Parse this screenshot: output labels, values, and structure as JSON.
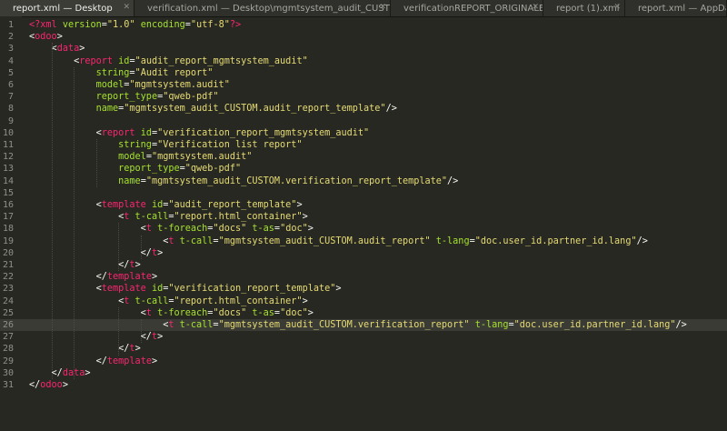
{
  "tabs": [
    {
      "label": "report.xml — Desktop",
      "close": "✕",
      "active": true,
      "width": 148
    },
    {
      "label": "verification.xml — Desktop\\mgmtsystem_audit_CUSTOM\\report",
      "close": "✕",
      "active": false,
      "width": 282
    },
    {
      "label": "verificationREPORT_ORIGINALE.xml",
      "close": "✕",
      "active": false,
      "width": 168
    },
    {
      "label": "report (1).xml",
      "close": "✕",
      "active": false,
      "width": 90
    },
    {
      "label": "report.xml — AppData\\Lo",
      "close": "",
      "active": false,
      "width": 112
    }
  ],
  "current_line": 26,
  "lines": [
    {
      "n": "1",
      "tokens": [
        [
          "<?",
          "#f92672"
        ],
        [
          "xml",
          "#f92672"
        ],
        [
          " version",
          "#a6e22e"
        ],
        [
          "=",
          "#f8f8f2"
        ],
        [
          "\"1.0\"",
          "#e6db74"
        ],
        [
          " encoding",
          "#a6e22e"
        ],
        [
          "=",
          "#f8f8f2"
        ],
        [
          "\"utf-8\"",
          "#e6db74"
        ],
        [
          "?>",
          "#f92672"
        ]
      ]
    },
    {
      "n": "2",
      "tokens": [
        [
          "<",
          "#f8f8f2"
        ],
        [
          "odoo",
          "#f92672"
        ],
        [
          ">",
          "#f8f8f2"
        ]
      ]
    },
    {
      "n": "3",
      "tokens": [
        [
          "    ",
          "#f8f8f2"
        ],
        [
          "<",
          "#f8f8f2"
        ],
        [
          "data",
          "#f92672"
        ],
        [
          ">",
          "#f8f8f2"
        ]
      ]
    },
    {
      "n": "4",
      "tokens": [
        [
          "        ",
          "#f8f8f2"
        ],
        [
          "<",
          "#f8f8f2"
        ],
        [
          "report",
          "#f92672"
        ],
        [
          " id",
          "#a6e22e"
        ],
        [
          "=",
          "#f8f8f2"
        ],
        [
          "\"audit_report_mgmtsystem_audit\"",
          "#e6db74"
        ]
      ]
    },
    {
      "n": "5",
      "tokens": [
        [
          "            ",
          "#f8f8f2"
        ],
        [
          "string",
          "#a6e22e"
        ],
        [
          "=",
          "#f8f8f2"
        ],
        [
          "\"Audit report\"",
          "#e6db74"
        ]
      ]
    },
    {
      "n": "6",
      "tokens": [
        [
          "            ",
          "#f8f8f2"
        ],
        [
          "model",
          "#a6e22e"
        ],
        [
          "=",
          "#f8f8f2"
        ],
        [
          "\"mgmtsystem.audit\"",
          "#e6db74"
        ]
      ]
    },
    {
      "n": "7",
      "tokens": [
        [
          "            ",
          "#f8f8f2"
        ],
        [
          "report_type",
          "#a6e22e"
        ],
        [
          "=",
          "#f8f8f2"
        ],
        [
          "\"qweb-pdf\"",
          "#e6db74"
        ]
      ]
    },
    {
      "n": "8",
      "tokens": [
        [
          "            ",
          "#f8f8f2"
        ],
        [
          "name",
          "#a6e22e"
        ],
        [
          "=",
          "#f8f8f2"
        ],
        [
          "\"mgmtsystem_audit_CUSTOM.audit_report_template\"",
          "#e6db74"
        ],
        [
          "/>",
          "#f8f8f2"
        ]
      ]
    },
    {
      "n": "9",
      "tokens": []
    },
    {
      "n": "10",
      "tokens": [
        [
          "            ",
          "#f8f8f2"
        ],
        [
          "<",
          "#f8f8f2"
        ],
        [
          "report",
          "#f92672"
        ],
        [
          " id",
          "#a6e22e"
        ],
        [
          "=",
          "#f8f8f2"
        ],
        [
          "\"verification_report_mgmtsystem_audit\"",
          "#e6db74"
        ]
      ]
    },
    {
      "n": "11",
      "tokens": [
        [
          "                ",
          "#f8f8f2"
        ],
        [
          "string",
          "#a6e22e"
        ],
        [
          "=",
          "#f8f8f2"
        ],
        [
          "\"Verification list report\"",
          "#e6db74"
        ]
      ]
    },
    {
      "n": "12",
      "tokens": [
        [
          "                ",
          "#f8f8f2"
        ],
        [
          "model",
          "#a6e22e"
        ],
        [
          "=",
          "#f8f8f2"
        ],
        [
          "\"mgmtsystem.audit\"",
          "#e6db74"
        ]
      ]
    },
    {
      "n": "13",
      "tokens": [
        [
          "                ",
          "#f8f8f2"
        ],
        [
          "report_type",
          "#a6e22e"
        ],
        [
          "=",
          "#f8f8f2"
        ],
        [
          "\"qweb-pdf\"",
          "#e6db74"
        ]
      ]
    },
    {
      "n": "14",
      "tokens": [
        [
          "                ",
          "#f8f8f2"
        ],
        [
          "name",
          "#a6e22e"
        ],
        [
          "=",
          "#f8f8f2"
        ],
        [
          "\"mgmtsystem_audit_CUSTOM.verification_report_template\"",
          "#e6db74"
        ],
        [
          "/>",
          "#f8f8f2"
        ]
      ]
    },
    {
      "n": "15",
      "tokens": []
    },
    {
      "n": "16",
      "tokens": [
        [
          "            ",
          "#f8f8f2"
        ],
        [
          "<",
          "#f8f8f2"
        ],
        [
          "template",
          "#f92672"
        ],
        [
          " id",
          "#a6e22e"
        ],
        [
          "=",
          "#f8f8f2"
        ],
        [
          "\"audit_report_template\"",
          "#e6db74"
        ],
        [
          ">",
          "#f8f8f2"
        ]
      ]
    },
    {
      "n": "17",
      "tokens": [
        [
          "                ",
          "#f8f8f2"
        ],
        [
          "<",
          "#f8f8f2"
        ],
        [
          "t",
          "#f92672"
        ],
        [
          " t-call",
          "#a6e22e"
        ],
        [
          "=",
          "#f8f8f2"
        ],
        [
          "\"report.html_container\"",
          "#e6db74"
        ],
        [
          ">",
          "#f8f8f2"
        ]
      ]
    },
    {
      "n": "18",
      "tokens": [
        [
          "                    ",
          "#f8f8f2"
        ],
        [
          "<",
          "#f8f8f2"
        ],
        [
          "t",
          "#f92672"
        ],
        [
          " t-foreach",
          "#a6e22e"
        ],
        [
          "=",
          "#f8f8f2"
        ],
        [
          "\"docs\"",
          "#e6db74"
        ],
        [
          " t-as",
          "#a6e22e"
        ],
        [
          "=",
          "#f8f8f2"
        ],
        [
          "\"doc\"",
          "#e6db74"
        ],
        [
          ">",
          "#f8f8f2"
        ]
      ]
    },
    {
      "n": "19",
      "tokens": [
        [
          "                        ",
          "#f8f8f2"
        ],
        [
          "<",
          "#f8f8f2"
        ],
        [
          "t",
          "#f92672"
        ],
        [
          " t-call",
          "#a6e22e"
        ],
        [
          "=",
          "#f8f8f2"
        ],
        [
          "\"mgmtsystem_audit_CUSTOM.audit_report\"",
          "#e6db74"
        ],
        [
          " t-lang",
          "#a6e22e"
        ],
        [
          "=",
          "#f8f8f2"
        ],
        [
          "\"doc.user_id.partner_id.lang\"",
          "#e6db74"
        ],
        [
          "/>",
          "#f8f8f2"
        ]
      ]
    },
    {
      "n": "20",
      "tokens": [
        [
          "                    ",
          "#f8f8f2"
        ],
        [
          "</",
          "#f8f8f2"
        ],
        [
          "t",
          "#f92672"
        ],
        [
          ">",
          "#f8f8f2"
        ]
      ]
    },
    {
      "n": "21",
      "tokens": [
        [
          "                ",
          "#f8f8f2"
        ],
        [
          "</",
          "#f8f8f2"
        ],
        [
          "t",
          "#f92672"
        ],
        [
          ">",
          "#f8f8f2"
        ]
      ]
    },
    {
      "n": "22",
      "tokens": [
        [
          "            ",
          "#f8f8f2"
        ],
        [
          "</",
          "#f8f8f2"
        ],
        [
          "template",
          "#f92672"
        ],
        [
          ">",
          "#f8f8f2"
        ]
      ]
    },
    {
      "n": "23",
      "tokens": [
        [
          "            ",
          "#f8f8f2"
        ],
        [
          "<",
          "#f8f8f2"
        ],
        [
          "template",
          "#f92672"
        ],
        [
          " id",
          "#a6e22e"
        ],
        [
          "=",
          "#f8f8f2"
        ],
        [
          "\"verification_report_template\"",
          "#e6db74"
        ],
        [
          ">",
          "#f8f8f2"
        ]
      ]
    },
    {
      "n": "24",
      "tokens": [
        [
          "                ",
          "#f8f8f2"
        ],
        [
          "<",
          "#f8f8f2"
        ],
        [
          "t",
          "#f92672"
        ],
        [
          " t-call",
          "#a6e22e"
        ],
        [
          "=",
          "#f8f8f2"
        ],
        [
          "\"report.html_container\"",
          "#e6db74"
        ],
        [
          ">",
          "#f8f8f2"
        ]
      ]
    },
    {
      "n": "25",
      "tokens": [
        [
          "                    ",
          "#f8f8f2"
        ],
        [
          "<",
          "#f8f8f2"
        ],
        [
          "t",
          "#f92672"
        ],
        [
          " t-foreach",
          "#a6e22e"
        ],
        [
          "=",
          "#f8f8f2"
        ],
        [
          "\"docs\"",
          "#e6db74"
        ],
        [
          " t-as",
          "#a6e22e"
        ],
        [
          "=",
          "#f8f8f2"
        ],
        [
          "\"doc\"",
          "#e6db74"
        ],
        [
          ">",
          "#f8f8f2"
        ]
      ]
    },
    {
      "n": "26",
      "tokens": [
        [
          "                        ",
          "#f8f8f2"
        ],
        [
          "<",
          "#f8f8f2"
        ],
        [
          "t",
          "#f92672"
        ],
        [
          " t-call",
          "#a6e22e"
        ],
        [
          "=",
          "#f8f8f2"
        ],
        [
          "\"mgmtsystem_audit_CUSTOM.verification_report\"",
          "#e6db74"
        ],
        [
          " t-lang",
          "#a6e22e"
        ],
        [
          "=",
          "#f8f8f2"
        ],
        [
          "\"doc.user_id.partner_id.lang\"",
          "#e6db74"
        ],
        [
          "/>",
          "#f8f8f2"
        ]
      ]
    },
    {
      "n": "27",
      "tokens": [
        [
          "                    ",
          "#f8f8f2"
        ],
        [
          "</",
          "#f8f8f2"
        ],
        [
          "t",
          "#f92672"
        ],
        [
          ">",
          "#f8f8f2"
        ]
      ]
    },
    {
      "n": "28",
      "tokens": [
        [
          "                ",
          "#f8f8f2"
        ],
        [
          "</",
          "#f8f8f2"
        ],
        [
          "t",
          "#f92672"
        ],
        [
          ">",
          "#f8f8f2"
        ]
      ]
    },
    {
      "n": "29",
      "tokens": [
        [
          "            ",
          "#f8f8f2"
        ],
        [
          "</",
          "#f8f8f2"
        ],
        [
          "template",
          "#f92672"
        ],
        [
          ">",
          "#f8f8f2"
        ]
      ]
    },
    {
      "n": "30",
      "tokens": [
        [
          "    ",
          "#f8f8f2"
        ],
        [
          "</",
          "#f8f8f2"
        ],
        [
          "data",
          "#f92672"
        ],
        [
          ">",
          "#f8f8f2"
        ]
      ]
    },
    {
      "n": "31",
      "tokens": [
        [
          "</",
          "#f8f8f2"
        ],
        [
          "odoo",
          "#f92672"
        ],
        [
          ">",
          "#f8f8f2"
        ]
      ]
    }
  ],
  "colors": {
    "background": "#272822",
    "current_line": "#3a3b35",
    "tag": "#f92672",
    "attribute": "#a6e22e",
    "string": "#e6db74",
    "text": "#f8f8f2",
    "line_number": "#8f908a"
  }
}
